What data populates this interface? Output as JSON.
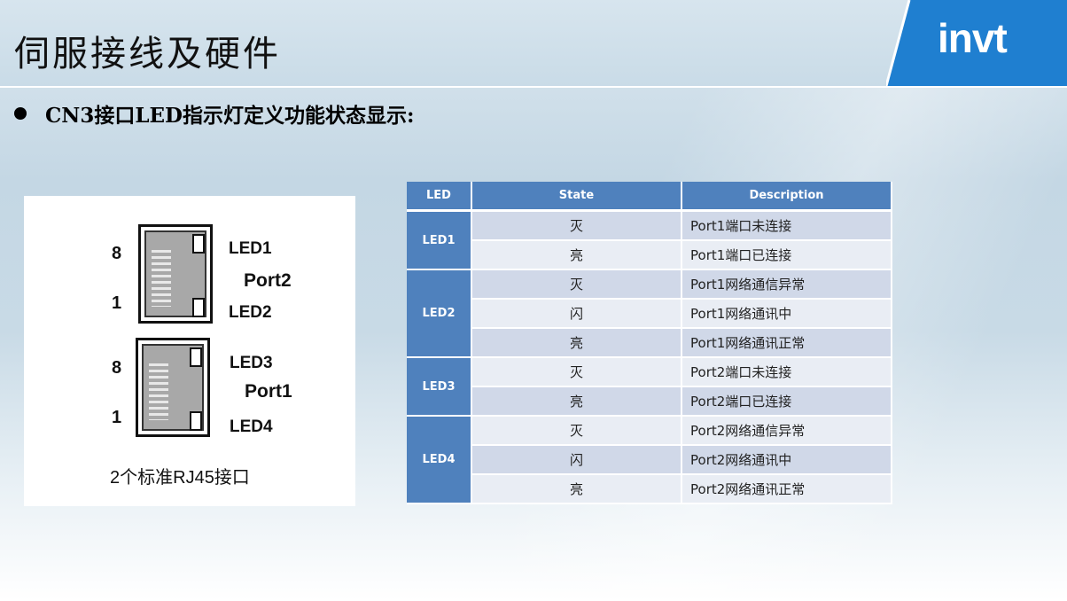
{
  "title": "伺服接线及硬件",
  "logo": "invt",
  "bullet": "CN3接口LED指示灯定义功能状态显示:",
  "figure": {
    "pin_top": "8",
    "pin_bottom": "1",
    "led1": "LED1",
    "led2": "LED2",
    "led3": "LED3",
    "led4": "LED4",
    "port_upper": "Port2",
    "port_lower": "Port1",
    "caption": "2个标准RJ45接口"
  },
  "colors": {
    "header_blue": "#4f81bd",
    "row_dark": "#d0d8e8",
    "row_light": "#e9edf4",
    "logo_blue": "#1f7fd0"
  },
  "table": {
    "headers": [
      "LED",
      "State",
      "Description"
    ],
    "groups": [
      {
        "led": "LED1",
        "rows": [
          {
            "state": "灭",
            "desc": "Port1端口未连接"
          },
          {
            "state": "亮",
            "desc": "Port1端口已连接"
          }
        ]
      },
      {
        "led": "LED2",
        "rows": [
          {
            "state": "灭",
            "desc": "Port1网络通信异常"
          },
          {
            "state": "闪",
            "desc": "Port1网络通讯中"
          },
          {
            "state": "亮",
            "desc": "Port1网络通讯正常"
          }
        ]
      },
      {
        "led": "LED3",
        "rows": [
          {
            "state": "灭",
            "desc": "Port2端口未连接"
          },
          {
            "state": "亮",
            "desc": "Port2端口已连接"
          }
        ]
      },
      {
        "led": "LED4",
        "rows": [
          {
            "state": "灭",
            "desc": "Port2网络通信异常"
          },
          {
            "state": "闪",
            "desc": "Port2网络通讯中"
          },
          {
            "state": "亮",
            "desc": "Port2网络通讯正常"
          }
        ]
      }
    ]
  }
}
